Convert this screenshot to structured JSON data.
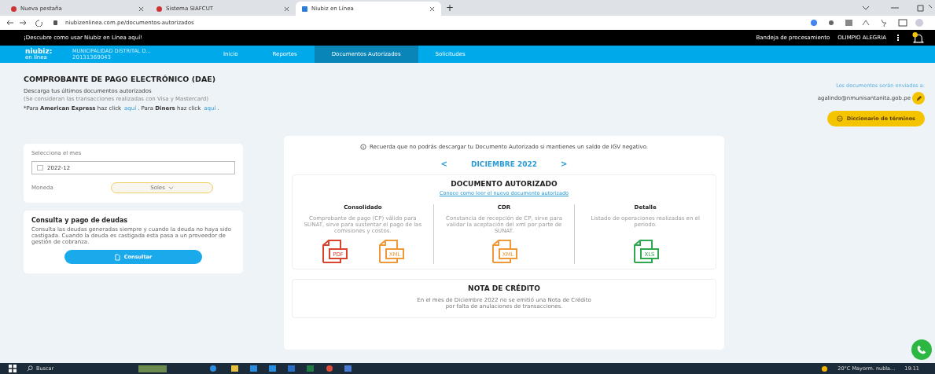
{
  "browser": {
    "tabs": [
      {
        "title": "Nueva pestaña",
        "selected": false
      },
      {
        "title": "Sistema SIAFCUT",
        "selected": false
      },
      {
        "title": "Niubiz en Línea",
        "selected": true
      }
    ],
    "new_tab": "+",
    "url": "niubizenlinea.com.pe/documentos-autorizados"
  },
  "promo_bar": {
    "text": "¡Descubre como usar Niubiz en Línea aquí!",
    "inbox": "Bandeja de procesamiento",
    "user": "OLIMPIO ALEGRIA",
    "notifications": true
  },
  "nav": {
    "logo": "niubiz:",
    "logo_sub": "en línea",
    "company": "MUNICIPALIDAD DISTRITAL D...",
    "company_id": "20131369043",
    "items": [
      {
        "label": "Inicio",
        "selected": false
      },
      {
        "label": "Reportes",
        "selected": false
      },
      {
        "label": "Documentos Autorizados",
        "selected": true
      },
      {
        "label": "Solicitudes",
        "selected": false
      }
    ]
  },
  "header": {
    "title": "COMPROBANTE DE PAGO ELECTRÓNICO (DAE)",
    "subtitle": "Descarga tus últimos documentos autorizados",
    "note": "(Se consideran las transacciones realizadas con Visa y Mastercard)",
    "other_cards": "*Para **American Express** haz click",
    "link_1": "aquí",
    "mid": ". Para **Diners** haz click",
    "link_2": "aquí",
    "end": ".",
    "email_label": "Los documentos serán enviados a:",
    "email": "agalindo@nmunisantanita.gob.pe",
    "dictionary_button": "Diccionario de términos"
  },
  "filters": {
    "month_label": "Selecciona el mes",
    "month": "2022-12",
    "currency_label": "Moneda",
    "currency": "Soles"
  },
  "debts": {
    "title": "Consulta y pago de deudas",
    "text": "Consulta las deudas generadas siempre y cuando la deuda no haya sido castigada. Cuando la deuda es castigada esta pasa a un proveedor de gestión de cobranza.",
    "button": "Consultar"
  },
  "notice": "Recuerda que no podrás descargar tu Documento Autorizado si mantienes un saldo de IGV negativo.",
  "period": {
    "prev": "<",
    "label": "DICIEMBRE 2022",
    "next": ">"
  },
  "authorized": {
    "title": "DOCUMENTO AUTORIZADO",
    "link": "Conoce como leer el nuevo documento autorizado",
    "columns": [
      {
        "title": "Consolidado",
        "text": "Comprobante de pago (CP) válido para SUNAT, sirve para sustentar el pago de las comisiones y costos.",
        "files": [
          {
            "type": "PDF",
            "color": "#d9442f"
          },
          {
            "type": "XML",
            "color": "#ef9a3a"
          }
        ]
      },
      {
        "title": "CDR",
        "text": "Constancia de recepción de CP, sirve para validar la aceptación del xml por parte de SUNAT.",
        "files": [
          {
            "type": "XML",
            "color": "#ef9a3a"
          }
        ]
      },
      {
        "title": "Detalle",
        "text": "Listado de operaciones realizadas en el periodo.",
        "files": [
          {
            "type": "XLS",
            "color": "#2fa84f"
          }
        ]
      }
    ]
  },
  "credit_note": {
    "title": "NOTA DE CRÉDITO",
    "text": "En el mes de Diciembre 2022 no se emitió una Nota de Crédito por falta de anulaciones de transacciones."
  },
  "taskbar": {
    "search": "Buscar",
    "weather": "20°C Mayorm. nubla...",
    "time": "19:11"
  }
}
